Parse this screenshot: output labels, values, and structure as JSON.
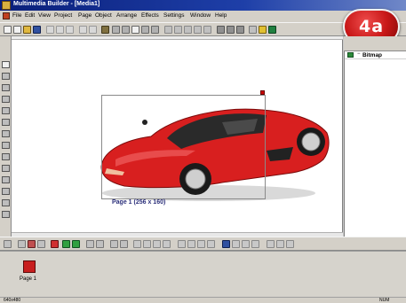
{
  "window": {
    "title": "Multimedia Builder - [Media1]"
  },
  "badge": {
    "label": "4a"
  },
  "menubar": {
    "items": [
      "File",
      "Edit",
      "View",
      "Project",
      "Page",
      "Object",
      "Arrange",
      "Effects",
      "Settings",
      "Window",
      "Help"
    ]
  },
  "object_panel": {
    "toggle": "−",
    "item_label": "Bitmap",
    "icon": "bitmap-icon"
  },
  "canvas": {
    "object_name": "car-image",
    "selection_label": "Page 1 (256 x 160)",
    "colors": {
      "selection": "#8a8a8a",
      "car_body": "#d81f1f"
    }
  },
  "pages_panel": {
    "pages": [
      {
        "label": "Page 1",
        "color": "#c81e1e"
      }
    ]
  },
  "statusbar": {
    "left": "640x480",
    "right": "NUM"
  },
  "colors": {
    "chrome": "#d4d0c8",
    "titlebar": "#0a1f7a",
    "badge": "#c81818"
  }
}
